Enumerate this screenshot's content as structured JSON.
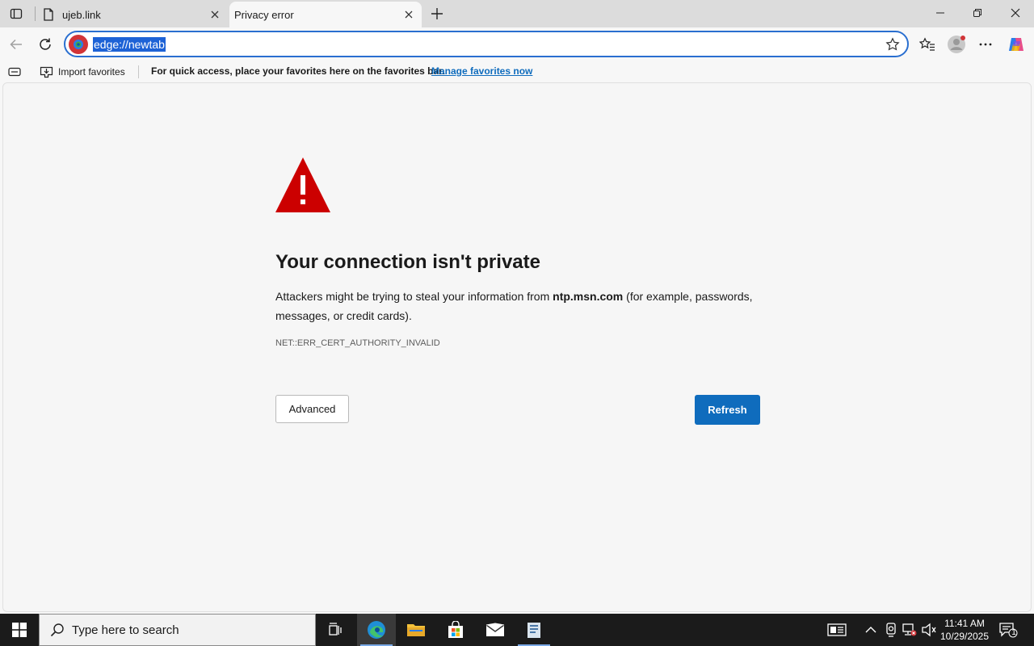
{
  "tabs": [
    {
      "title": "ujeb.link",
      "active": false
    },
    {
      "title": "Privacy error",
      "active": true
    }
  ],
  "address_bar": {
    "url": "edge://newtab"
  },
  "favorites_bar": {
    "import_label": "Import favorites",
    "hint": "For quick access, place your favorites here on the favorites bar.",
    "manage_link": "Manage favorites now"
  },
  "error_page": {
    "headline": "Your connection isn't private",
    "message_pre": "Attackers might be trying to steal your information from ",
    "host": "ntp.msn.com",
    "message_post": " (for example, passwords, messages, or credit cards).",
    "error_code": "NET::ERR_CERT_AUTHORITY_INVALID",
    "advanced_label": "Advanced",
    "refresh_label": "Refresh"
  },
  "taskbar": {
    "search_placeholder": "Type here to search",
    "time": "11:41 AM",
    "date": "10/29/2025",
    "notification_count": "1"
  },
  "colors": {
    "accent": "#0f6cbd",
    "warning": "#cc0000",
    "url_highlight": "#1d62d6"
  }
}
